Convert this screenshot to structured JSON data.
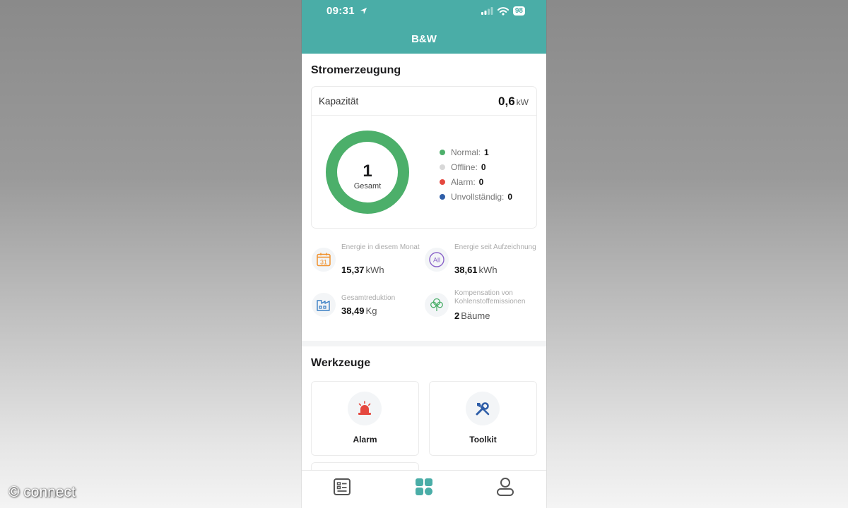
{
  "status_bar": {
    "time": "09:31",
    "battery": "98"
  },
  "header": {
    "title": "B&W",
    "accent_color": "#4aada7"
  },
  "generation": {
    "title": "Stromerzeugung",
    "capacity_label": "Kapazität",
    "capacity_value": "0,6",
    "capacity_unit": "kW",
    "donut_count": "1",
    "donut_label": "Gesamt",
    "donut_color": "#4caf6a",
    "legend": [
      {
        "label": "Normal:",
        "value": "1",
        "color": "#4caf6a"
      },
      {
        "label": "Offline:",
        "value": "0",
        "color": "#d8d8d8"
      },
      {
        "label": "Alarm:",
        "value": "0",
        "color": "#e5483f"
      },
      {
        "label": "Unvollständig:",
        "value": "0",
        "color": "#2f5ea8"
      }
    ],
    "stats": [
      {
        "label": "Energie in diesem Monat",
        "value": "15,37",
        "unit": "kWh",
        "icon": "calendar-icon"
      },
      {
        "label": "Energie seit Aufzeichnung",
        "value": "38,61",
        "unit": "kWh",
        "icon": "all-icon"
      },
      {
        "label": "Gesamtreduktion",
        "value": "38,49",
        "unit": "Kg",
        "icon": "factory-icon"
      },
      {
        "label": "Kompensation von Kohlenstoffemissionen",
        "value": "2",
        "unit": "Bäume",
        "icon": "tree-icon"
      }
    ]
  },
  "tools": {
    "title": "Werkzeuge",
    "items": [
      {
        "label": "Alarm",
        "icon": "siren-icon"
      },
      {
        "label": "Toolkit",
        "icon": "tools-icon"
      }
    ]
  },
  "tabbar": {
    "items": [
      "list-icon",
      "grid-icon",
      "user-icon"
    ]
  },
  "watermark": "© connect"
}
